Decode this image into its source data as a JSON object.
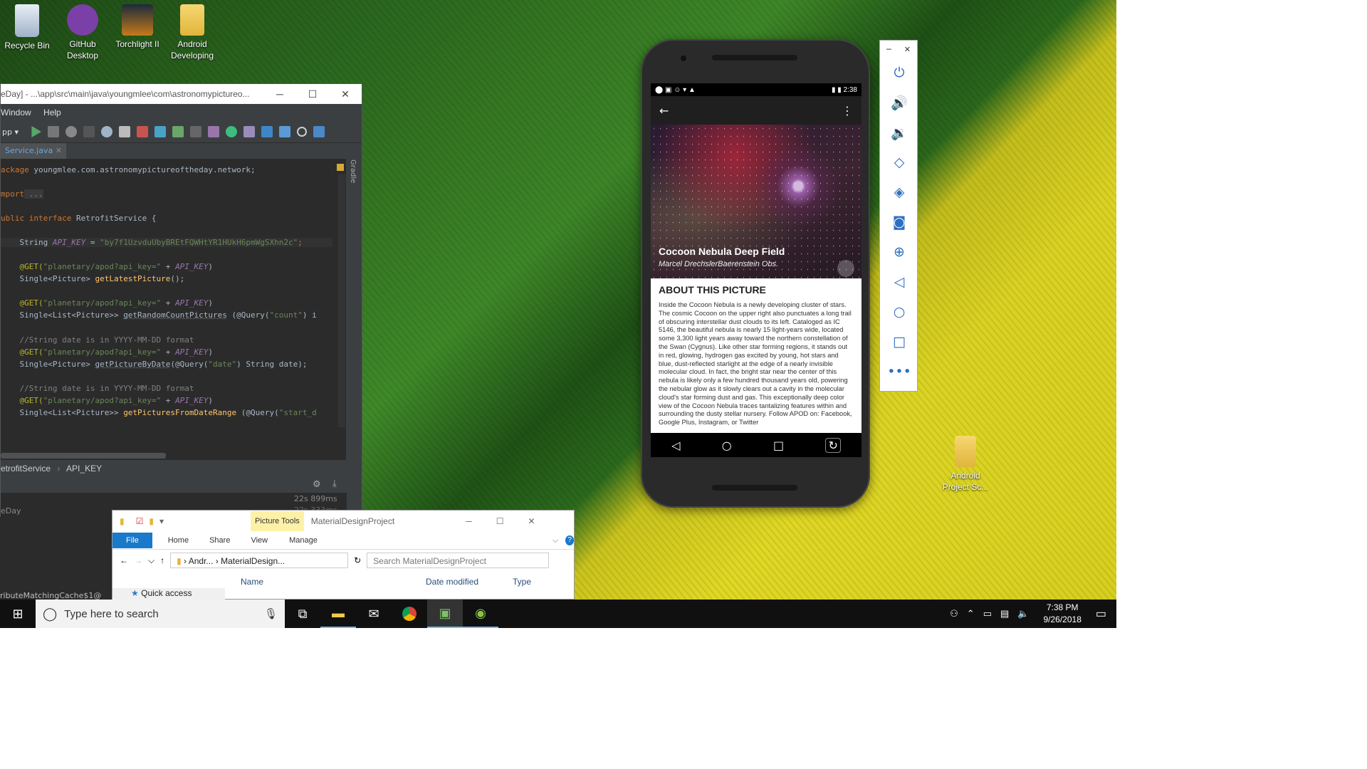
{
  "desktop": {
    "icons": [
      {
        "label": "Recycle Bin"
      },
      {
        "label": "GitHub Desktop"
      },
      {
        "label": "Torchlight II"
      },
      {
        "label": "Android Developing"
      },
      {
        "label": "Android Project Sc..."
      }
    ]
  },
  "android_studio": {
    "title": "eDay] - ...\\app\\src\\main\\java\\youngmlee\\com\\astronomypictureo...",
    "menu": [
      "Window",
      "Help"
    ],
    "run_config": "pp",
    "tab": "Service.java",
    "side_panel": "Gradle",
    "code": {
      "l1_kw": "ackage",
      "l1_rest": " youngmlee.com.astronomypictureoftheday.network;",
      "l2_kw": "mport",
      "l2_rest": " ...",
      "l3_kw": "ublic interface",
      "l3_rest": " RetrofitService {",
      "l4_a": "    String ",
      "l4_b": "API_KEY",
      "l4_c": " = ",
      "l4_d": "\"by7f1UzvduUbyBREtFQWHtYR1HUkH6pmWgSXhn2c\"",
      "l4_e": ";",
      "l5_a": "    @GET(",
      "l5_b": "\"planetary/apod?api_key=\"",
      "l5_c": " + ",
      "l5_d": "API_KEY",
      "l5_e": ")",
      "l6_a": "    Single<Picture> ",
      "l6_b": "getLatestPicture",
      "l6_c": "();",
      "l7_a": "    @GET(",
      "l7_b": "\"planetary/apod?api_key=\"",
      "l7_c": " + ",
      "l7_d": "API_KEY",
      "l7_e": ")",
      "l8_a": "    Single<List<Picture>> ",
      "l8_b": "getRandomCountPictures",
      "l8_c": " (@Query(",
      "l8_d": "\"count\"",
      "l8_e": ") i",
      "l9": "    //String date is in YYYY-MM-DD format",
      "l10_a": "    @GET(",
      "l10_b": "\"planetary/apod?api_key=\"",
      "l10_c": " + ",
      "l10_d": "API_KEY",
      "l10_e": ")",
      "l11_a": "    Single<Picture> ",
      "l11_b": "getPictureByDate",
      "l11_c": "(@Query(",
      "l11_d": "\"date\"",
      "l11_e": ") String date);",
      "l12": "    //String date is in YYYY-MM-DD format",
      "l13_a": "    @GET(",
      "l13_b": "\"planetary/apod?api_key=\"",
      "l13_c": " + ",
      "l13_d": "API_KEY",
      "l13_e": ")",
      "l14_a": "    Single<List<Picture>> ",
      "l14_b": "getPicturesFromDateRange",
      "l14_c": " (@Query(",
      "l14_d": "\"start_d",
      "l14_e": ""
    },
    "breadcrumb": [
      "etrofitService",
      "API_KEY"
    ],
    "run_times": [
      "22s 899ms",
      "22s 333ms"
    ],
    "run_label": "eDay",
    "bottom_text": "ributeMatchingCache$1@"
  },
  "phone": {
    "time": "2:38",
    "picture_title": "Cocoon Nebula Deep Field",
    "picture_credit": "Marcel DrechslerBaerenstein Obs.",
    "about_heading": "ABOUT THIS PICTURE",
    "about_text": "Inside the Cocoon Nebula is a newly developing cluster of stars. The cosmic Cocoon on the upper right also punctuates a long trail of obscuring interstellar dust clouds to its left. Cataloged as IC 5146, the beautiful nebula is nearly 15 light-years wide, located some 3,300 light years away toward the northern constellation of the Swan (Cygnus). Like other star forming regions, it stands out in red, glowing, hydrogen gas excited by young, hot stars and blue, dust-reflected starlight at the edge of a nearly invisible molecular cloud. In fact, the bright star near the center of this nebula is likely only a few hundred thousand years old, powering the nebular glow as it slowly clears out a cavity in the molecular cloud's star forming dust and gas. This exceptionally deep color view of the Cocoon Nebula traces tantalizing features within and surrounding the dusty stellar nursery.   Follow APOD on: Facebook,  Google Plus,  Instagram, or Twitter"
  },
  "explorer": {
    "picture_tools": "Picture Tools",
    "title": "MaterialDesignProject",
    "ribbon": [
      "File",
      "Home",
      "Share",
      "View",
      "Manage"
    ],
    "address": [
      "Andr...",
      "MaterialDesign..."
    ],
    "search_placeholder": "Search MaterialDesignProject",
    "columns": [
      "Name",
      "Date modified",
      "Type"
    ],
    "quick_access": "Quick access"
  },
  "taskbar": {
    "search_placeholder": "Type here to search",
    "time": "7:38 PM",
    "date": "9/26/2018"
  },
  "colors": {
    "accent": "#0078d7",
    "emulator_icon": "#2f6fc1"
  }
}
